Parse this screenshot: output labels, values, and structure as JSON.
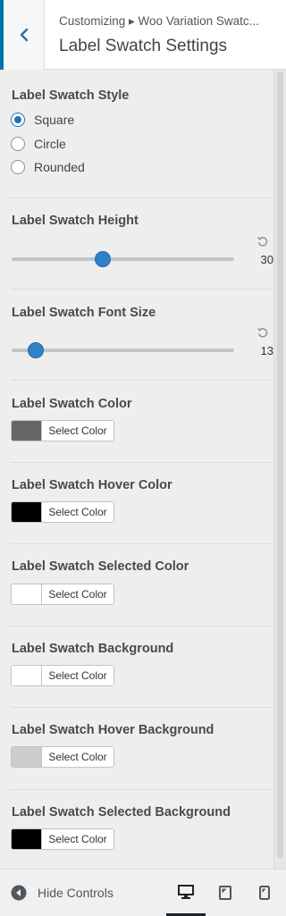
{
  "header": {
    "breadcrumb": "Customizing ▸ Woo Variation Swatc...",
    "title": "Label Swatch Settings"
  },
  "style_section": {
    "title": "Label Swatch Style",
    "options": [
      "Square",
      "Circle",
      "Rounded"
    ],
    "selected": "Square"
  },
  "height_section": {
    "title": "Label Swatch Height",
    "value": "30"
  },
  "font_section": {
    "title": "Label Swatch Font Size",
    "value": "13"
  },
  "color_settings": [
    {
      "title": "Label Swatch Color",
      "button": "Select Color",
      "color": "#666666"
    },
    {
      "title": "Label Swatch Hover Color",
      "button": "Select Color",
      "color": "#000000"
    },
    {
      "title": "Label Swatch Selected Color",
      "button": "Select Color",
      "color": "#ffffff"
    },
    {
      "title": "Label Swatch Background",
      "button": "Select Color",
      "color": "#ffffff"
    },
    {
      "title": "Label Swatch Hover Background",
      "button": "Select Color",
      "color": "#cccccc"
    },
    {
      "title": "Label Swatch Selected Background",
      "button": "Select Color",
      "color": "#000000"
    }
  ],
  "footer": {
    "hide_controls": "Hide Controls"
  },
  "colors": {
    "accent": "#2271b1",
    "slider_handle": "#2f82c5",
    "back_bar": "#0073aa"
  }
}
